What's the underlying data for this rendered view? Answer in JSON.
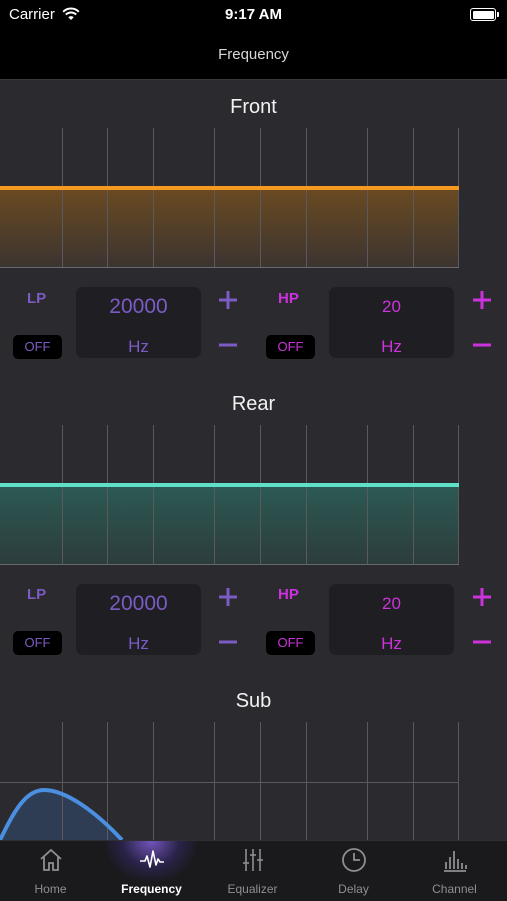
{
  "status": {
    "carrier": "Carrier",
    "time": "9:17 AM"
  },
  "nav": {
    "title": "Frequency"
  },
  "colors": {
    "lp": "#7b5cc4",
    "hp": "#cc33dd",
    "front_line": "#f59a1e",
    "rear_line": "#5fe0c8",
    "sub_line": "#4a8fe0",
    "plus_minus": "#cc33dd"
  },
  "sections": [
    {
      "title": "Front",
      "lp": {
        "label": "LP",
        "toggle": "OFF",
        "value": "20000",
        "unit": "Hz"
      },
      "hp": {
        "label": "HP",
        "toggle": "OFF",
        "value": "20",
        "unit": "Hz"
      }
    },
    {
      "title": "Rear",
      "lp": {
        "label": "LP",
        "toggle": "OFF",
        "value": "20000",
        "unit": "Hz"
      },
      "hp": {
        "label": "HP",
        "toggle": "OFF",
        "value": "20",
        "unit": "Hz"
      }
    },
    {
      "title": "Sub"
    }
  ],
  "controls": {
    "plus": "+",
    "minus": "−"
  },
  "tabs": [
    {
      "label": "Home",
      "icon": "home-icon"
    },
    {
      "label": "Frequency",
      "icon": "waveform-icon",
      "active": true
    },
    {
      "label": "Equalizer",
      "icon": "sliders-icon"
    },
    {
      "label": "Delay",
      "icon": "clock-icon"
    },
    {
      "label": "Channel",
      "icon": "bars-icon"
    }
  ]
}
